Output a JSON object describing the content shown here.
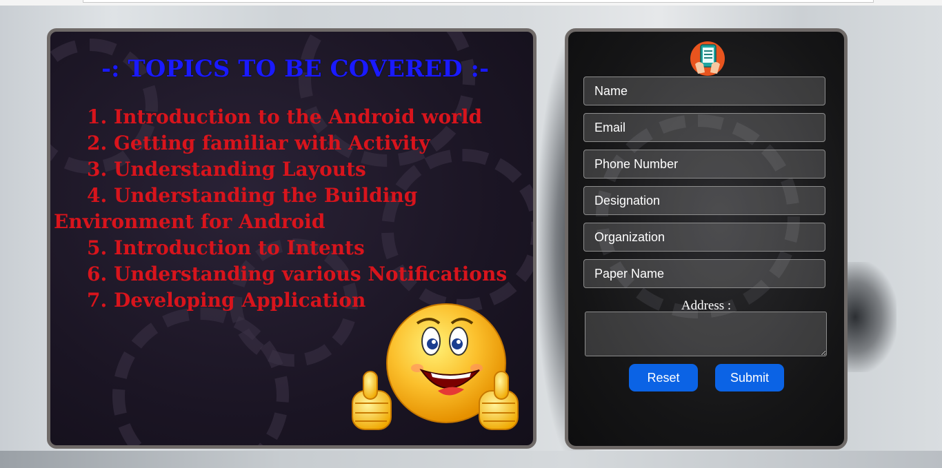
{
  "topics": {
    "title": "-: Topics to be covered :-",
    "items": [
      "1. Introduction to the Android world",
      "2. Getting familiar with Activity",
      "3. Understanding Layouts",
      "4. Understanding the Building Environment for Android",
      "5. Introduction to Intents",
      "6. Understanding various Notifications",
      "7. Developing Application"
    ]
  },
  "form": {
    "logo_icon": "phone-in-hand-icon",
    "fields": {
      "name": "Name",
      "email": "Email",
      "phone": "Phone Number",
      "designation": "Designation",
      "organization": "Organization",
      "paper": "Paper Name"
    },
    "address_label": "Address :",
    "reset_label": "Reset",
    "submit_label": "Submit"
  },
  "colors": {
    "title": "#1a1aff",
    "topic_text": "#d8141c",
    "button": "#0b63e5"
  },
  "decor": {
    "smiley_icon": "thumbs-up-smiley-icon"
  }
}
